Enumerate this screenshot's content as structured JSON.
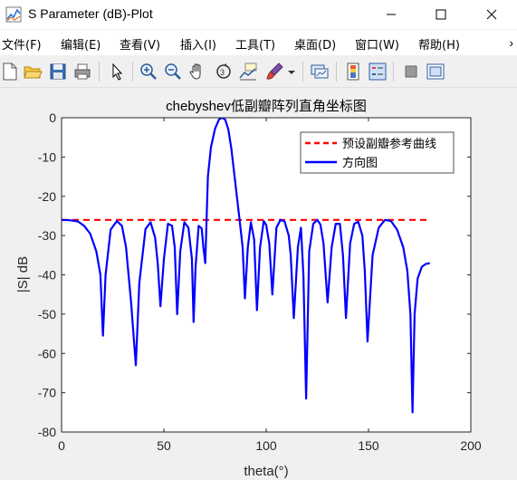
{
  "window": {
    "title": "S Parameter (dB)-Plot",
    "controls": {
      "minimize": "—",
      "maximize": "☐",
      "close": "✕"
    }
  },
  "menu": {
    "items": [
      "文件(F)",
      "编辑(E)",
      "查看(V)",
      "插入(I)",
      "工具(T)",
      "桌面(D)",
      "窗口(W)",
      "帮助(H)"
    ],
    "more": "›"
  },
  "toolbar": {
    "icons": [
      "new-file-icon",
      "open-folder-icon",
      "save-icon",
      "print-icon",
      "pointer-icon",
      "zoom-in-icon",
      "zoom-out-icon",
      "pan-hand-icon",
      "rotate-3d-icon",
      "data-cursor-icon",
      "brush-icon",
      "brush-dropdown-icon",
      "link-plot-icon",
      "colorbar-icon",
      "legend-icon",
      "hide-plot-tools-icon",
      "show-plot-tools-icon"
    ]
  },
  "colors": {
    "pattern": "#0000ff",
    "reference": "#ff0000",
    "axis": "#262626"
  },
  "chart_data": {
    "type": "line",
    "title": "chebyshev低副瓣阵列直角坐标图",
    "xlabel": "theta(°)",
    "ylabel": "|S| dB",
    "xlim": [
      0,
      200
    ],
    "ylim": [
      -80,
      0
    ],
    "xticks": [
      "0",
      "50",
      "100",
      "150",
      "200"
    ],
    "yticks": [
      "0",
      "-10",
      "-20",
      "-30",
      "-40",
      "-50",
      "-60",
      "-70",
      "-80"
    ],
    "grid": false,
    "legend": {
      "position": "top-right",
      "entries": [
        "预设副瓣参考曲线",
        "方向图"
      ]
    },
    "series": [
      {
        "name": "预设副瓣参考曲线",
        "style": "dashed",
        "color": "#ff0000",
        "x": [
          0,
          180
        ],
        "y": [
          -26,
          -26
        ]
      },
      {
        "name": "方向图",
        "style": "solid",
        "color": "#0000ff",
        "x": [
          0,
          4,
          8,
          11,
          14,
          17,
          19,
          20.2,
          21.5,
          24,
          27,
          29.5,
          31.5,
          34,
          36.3,
          38,
          41,
          43.5,
          45.7,
          47,
          48.3,
          50,
          52,
          54,
          55.3,
          56.5,
          58,
          60,
          62,
          63.7,
          64.5,
          65.5,
          67,
          68.5,
          69.3,
          70.2,
          71.5,
          73,
          75,
          77,
          78.5,
          80,
          81.5,
          83,
          85,
          87,
          88.5,
          89.6,
          91,
          92.5,
          94.1,
          95.5,
          97,
          98.8,
          100,
          101.5,
          103,
          105,
          107,
          109,
          111,
          112,
          113.5,
          115.5,
          117,
          118.2,
          119.5,
          121,
          123,
          125,
          126.5,
          128,
          130,
          132,
          134,
          136,
          137.5,
          139,
          141,
          143,
          145,
          147,
          148.2,
          149.5,
          152,
          155,
          158,
          161,
          164,
          167,
          169,
          170.5,
          171.5,
          172.5,
          174,
          176,
          178,
          180
        ],
        "y": [
          -26,
          -26.1,
          -26.4,
          -27.5,
          -29.5,
          -34,
          -40,
          -55.5,
          -40,
          -28.5,
          -26.3,
          -27.5,
          -33,
          -47,
          -63,
          -42,
          -28.3,
          -26.6,
          -30.5,
          -37,
          -48,
          -36,
          -27,
          -27.5,
          -33,
          -50,
          -34,
          -26.6,
          -28,
          -36,
          -52,
          -38,
          -27.5,
          -28.2,
          -33,
          -37,
          -15,
          -7.5,
          -2.8,
          -0.4,
          0,
          -0.5,
          -3,
          -8,
          -17,
          -26,
          -33,
          -46,
          -33,
          -26.6,
          -31,
          -49,
          -33,
          -26.3,
          -27.3,
          -32,
          -45,
          -28,
          -26,
          -26.4,
          -30,
          -35,
          -51,
          -33,
          -28,
          -40,
          -71.5,
          -34,
          -27,
          -26,
          -27.2,
          -32,
          -47,
          -33,
          -27,
          -27,
          -35,
          -51,
          -32,
          -27,
          -26.5,
          -30,
          -39,
          -57,
          -35,
          -28,
          -26,
          -26.3,
          -28.5,
          -33,
          -39,
          -50,
          -75,
          -50,
          -41,
          -38,
          -37.2,
          -37
        ]
      }
    ]
  }
}
